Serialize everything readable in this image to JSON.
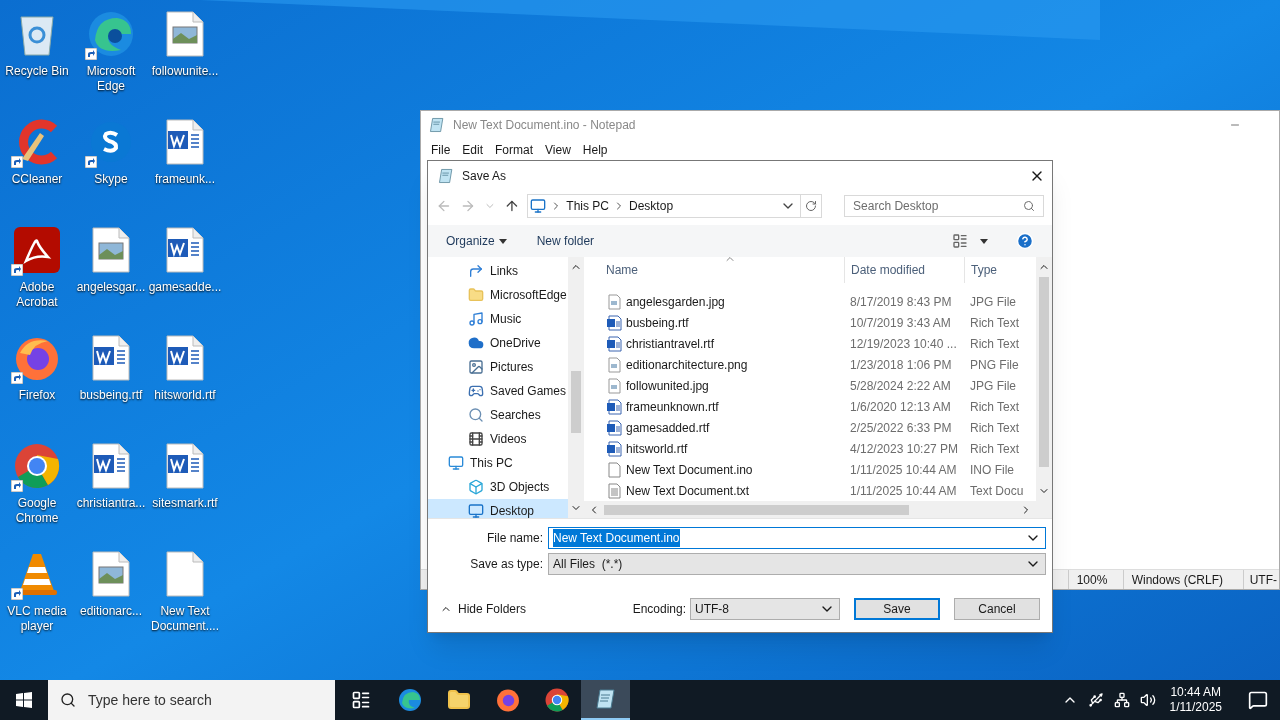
{
  "desktop_icons": [
    {
      "label": "Recycle Bin",
      "kind": "recycle",
      "shortcut": false
    },
    {
      "label": "CCleaner",
      "kind": "ccleaner",
      "shortcut": true
    },
    {
      "label": "Adobe Acrobat",
      "kind": "acrobat",
      "shortcut": true
    },
    {
      "label": "Firefox",
      "kind": "firefox",
      "shortcut": true
    },
    {
      "label": "Google Chrome",
      "kind": "chrome",
      "shortcut": true
    },
    {
      "label": "VLC media player",
      "kind": "vlc",
      "shortcut": true
    },
    {
      "label": "Microsoft Edge",
      "kind": "edge",
      "shortcut": true
    },
    {
      "label": "Skype",
      "kind": "skype",
      "shortcut": true
    },
    {
      "label": "angelesgar...",
      "kind": "image",
      "shortcut": false
    },
    {
      "label": "busbeing.rtf",
      "kind": "word",
      "shortcut": false
    },
    {
      "label": "christiantra...",
      "kind": "word",
      "shortcut": false
    },
    {
      "label": "editionarc...",
      "kind": "image",
      "shortcut": false
    },
    {
      "label": "followunite...",
      "kind": "image",
      "shortcut": false
    },
    {
      "label": "frameunk...",
      "kind": "word",
      "shortcut": false
    },
    {
      "label": "gamesadde...",
      "kind": "word",
      "shortcut": false
    },
    {
      "label": "hitsworld.rtf",
      "kind": "word",
      "shortcut": false
    },
    {
      "label": "sitesmark.rtf",
      "kind": "word",
      "shortcut": false
    },
    {
      "label": "New Text Document....",
      "kind": "blank",
      "shortcut": false
    }
  ],
  "notepad": {
    "title": "New Text Document.ino - Notepad",
    "menu": [
      "File",
      "Edit",
      "Format",
      "View",
      "Help"
    ],
    "status_bar": [
      "100%",
      "Windows (CRLF)",
      "UTF-"
    ]
  },
  "dialog": {
    "title": "Save As",
    "breadcrumb": [
      "This PC",
      "Desktop"
    ],
    "search": {
      "placeholder": "Search Desktop"
    },
    "toolbar": {
      "organize": "Organize",
      "new_folder": "New folder"
    },
    "nav_partial": [
      {
        "label": "Links",
        "kind": "links",
        "selected": false
      },
      {
        "label": "MicrosoftEdge",
        "kind": "folder",
        "selected": false
      },
      {
        "label": "Music",
        "kind": "music",
        "selected": false
      },
      {
        "label": "OneDrive",
        "kind": "onedrive",
        "selected": false
      },
      {
        "label": "Pictures",
        "kind": "pictures",
        "selected": false
      },
      {
        "label": "Saved Games",
        "kind": "games",
        "selected": false
      },
      {
        "label": "Searches",
        "kind": "searches",
        "selected": false
      },
      {
        "label": "Videos",
        "kind": "videos",
        "selected": false
      }
    ],
    "nav_tree": [
      {
        "label": "This PC",
        "kind": "pc",
        "selected": false,
        "children": [
          {
            "label": "3D Objects",
            "kind": "objects",
            "selected": false
          },
          {
            "label": "Desktop",
            "kind": "desktop",
            "selected": true
          }
        ]
      }
    ],
    "columns": [
      "Name",
      "Date modified",
      "Type"
    ],
    "files": [
      {
        "name": "angelesgarden.jpg",
        "kind": "image",
        "date": "8/17/2019 8:43 PM",
        "type": "JPG File"
      },
      {
        "name": "busbeing.rtf",
        "kind": "word",
        "date": "10/7/2019 3:43 AM",
        "type": "Rich Text"
      },
      {
        "name": "christiantravel.rtf",
        "kind": "word",
        "date": "12/19/2023 10:40 ...",
        "type": "Rich Text"
      },
      {
        "name": "editionarchitecture.png",
        "kind": "image",
        "date": "1/23/2018 1:06 PM",
        "type": "PNG File"
      },
      {
        "name": "followunited.jpg",
        "kind": "image",
        "date": "5/28/2024 2:22 AM",
        "type": "JPG File"
      },
      {
        "name": "frameunknown.rtf",
        "kind": "word",
        "date": "1/6/2020 12:13 AM",
        "type": "Rich Text"
      },
      {
        "name": "gamesadded.rtf",
        "kind": "word",
        "date": "2/25/2022 6:33 PM",
        "type": "Rich Text"
      },
      {
        "name": "hitsworld.rtf",
        "kind": "word",
        "date": "4/12/2023 10:27 PM",
        "type": "Rich Text"
      },
      {
        "name": "New Text Document.ino",
        "kind": "blank",
        "date": "1/11/2025 10:44 AM",
        "type": "INO File"
      },
      {
        "name": "New Text Document.txt",
        "kind": "text",
        "date": "1/11/2025 10:44 AM",
        "type": "Text Docu"
      }
    ],
    "file_name": {
      "label": "File name:",
      "value": "New Text Document.ino",
      "text_selected": true
    },
    "save_as_type": {
      "label": "Save as type:",
      "value": "All Files  (*.*)"
    },
    "hide_folders": "Hide Folders",
    "encoding": {
      "label": "Encoding:",
      "value": "UTF-8"
    },
    "buttons": [
      {
        "label": "Save",
        "default": true
      },
      {
        "label": "Cancel",
        "default": false
      }
    ]
  },
  "taskbar": {
    "search": {
      "placeholder": "Type here to search"
    },
    "apps": [
      {
        "kind": "taskview",
        "active": false
      },
      {
        "kind": "edge",
        "active": false
      },
      {
        "kind": "explorer",
        "active": false
      },
      {
        "kind": "firefox",
        "active": false
      },
      {
        "kind": "chrome",
        "active": false
      },
      {
        "kind": "notepad",
        "active": true
      }
    ],
    "time": "10:44 AM",
    "date": "1/11/2025"
  }
}
